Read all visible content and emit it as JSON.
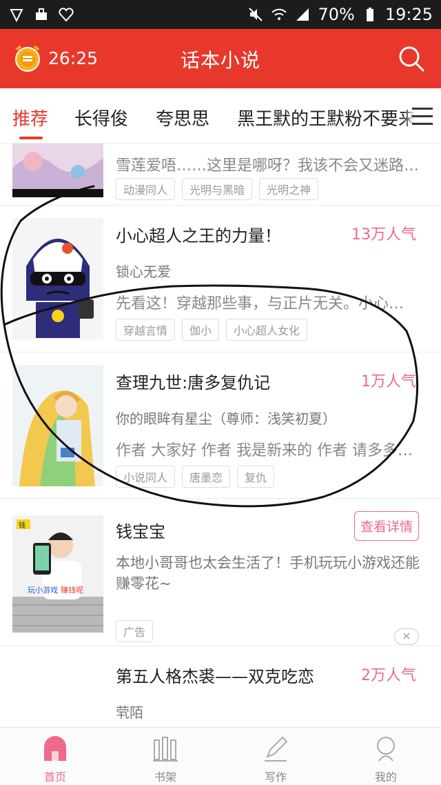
{
  "status_bar": {
    "battery": "70%",
    "time": "19:25",
    "icons": [
      "shield-heart-icon",
      "shopping-bag-icon",
      "heart-badge-icon",
      "mute-icon",
      "wifi-icon",
      "signal-icon",
      "battery-icon"
    ]
  },
  "header": {
    "timer_text": "26:25",
    "title": "话本小说",
    "timer_icon": "alarm-coin-icon",
    "search_icon": "search-icon",
    "brand_color": "#e8382c"
  },
  "tabs": {
    "items": [
      {
        "label": "推荐",
        "active": true
      },
      {
        "label": "长得俊",
        "active": false
      },
      {
        "label": "夸思思",
        "active": false
      },
      {
        "label": "黑王默的王默粉不要来",
        "active": false
      }
    ],
    "menu_icon": "menu-icon"
  },
  "books": [
    {
      "title": "",
      "popularity": "",
      "author": "",
      "desc": "雪莲爱唔……这里是哪呀？我该不会又迷路…",
      "tags": [
        "动漫同人",
        "光明与黑暗",
        "光明之神"
      ]
    },
    {
      "title": "小心超人之王的力量！",
      "popularity": "13万人气",
      "author": "锁心无爱",
      "desc": "先看这！穿越那些事，与正片无关。小心…",
      "tags": [
        "穿越言情",
        "伽小",
        "小心超人女化"
      ]
    },
    {
      "title": "查理九世:唐多复仇记",
      "popularity": "1万人气",
      "author": "你的眼眸有星尘（尊师：浅笑初夏）",
      "desc": "作者 大家好 作者 我是新来的 作者 请多多…",
      "tags": [
        "小说同人",
        "唐墨恋",
        "复仇"
      ]
    }
  ],
  "ad": {
    "title": "钱宝宝",
    "detail_button": "查看详情",
    "desc": "本地小哥哥也太会生活了！手机玩玩小游戏还能赚零花~",
    "tag": "广告",
    "close_symbol": "✕",
    "cover_badge": "钱",
    "cover_caption_a": "玩小游戏",
    "cover_caption_b": "赚钱呢"
  },
  "last_book": {
    "title": "第五人格杰裘——双克吃恋",
    "popularity": "2万人气",
    "author": "茕陌"
  },
  "bottom_nav": [
    {
      "label": "首页",
      "icon": "home-icon",
      "active": true
    },
    {
      "label": "书架",
      "icon": "bookshelf-icon",
      "active": false
    },
    {
      "label": "写作",
      "icon": "pen-icon",
      "active": false
    },
    {
      "label": "我的",
      "icon": "profile-icon",
      "active": false
    }
  ],
  "colors": {
    "accent_pink": "#ee6a8a",
    "brand_red": "#e8382c"
  }
}
